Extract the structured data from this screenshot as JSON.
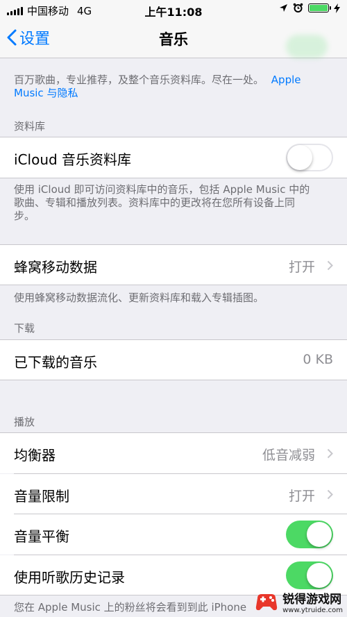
{
  "status_bar": {
    "carrier": "中国移动",
    "network": "4G",
    "time": "上午11:08",
    "battery_level": 1.0
  },
  "nav": {
    "back_label": "设置",
    "title": "音乐"
  },
  "intro_footer": {
    "text": "百万歌曲，专业推荐，及整个音乐资料库。尽在一处。",
    "link_line1": "Apple",
    "link_line2": "Music 与隐私"
  },
  "library": {
    "header": "资料库",
    "icloud_label": "iCloud 音乐资料库",
    "icloud_on": false,
    "icloud_footer_line1": "使用 iCloud 即可访问资料库中的音乐，包括 Apple Music 中的",
    "icloud_footer_line2": "歌曲、专辑和播放列表。资料库中的更改将在您所有设备上同",
    "icloud_footer_line3": "步。"
  },
  "cellular": {
    "label": "蜂窝移动数据",
    "value": "打开",
    "footer": "使用蜂窝移动数据流化、更新资料库和载入专辑插图。"
  },
  "downloads": {
    "header": "下载",
    "label": "已下载的音乐",
    "value": "0 KB"
  },
  "playback": {
    "header": "播放",
    "eq_label": "均衡器",
    "eq_value": "低音减弱",
    "volume_limit_label": "音量限制",
    "volume_limit_value": "打开",
    "sound_check_label": "音量平衡",
    "sound_check_on": true,
    "history_label": "使用听歌历史记录",
    "history_on": true,
    "footer_partial": "您在 Apple Music 上的粉丝将会看到到此 iPhone"
  },
  "watermark": {
    "title": "锐得游戏网",
    "url": "www.ytruide.com"
  },
  "colors": {
    "accent": "#007aff",
    "toggle_on": "#4cd964",
    "background": "#efeff4"
  }
}
